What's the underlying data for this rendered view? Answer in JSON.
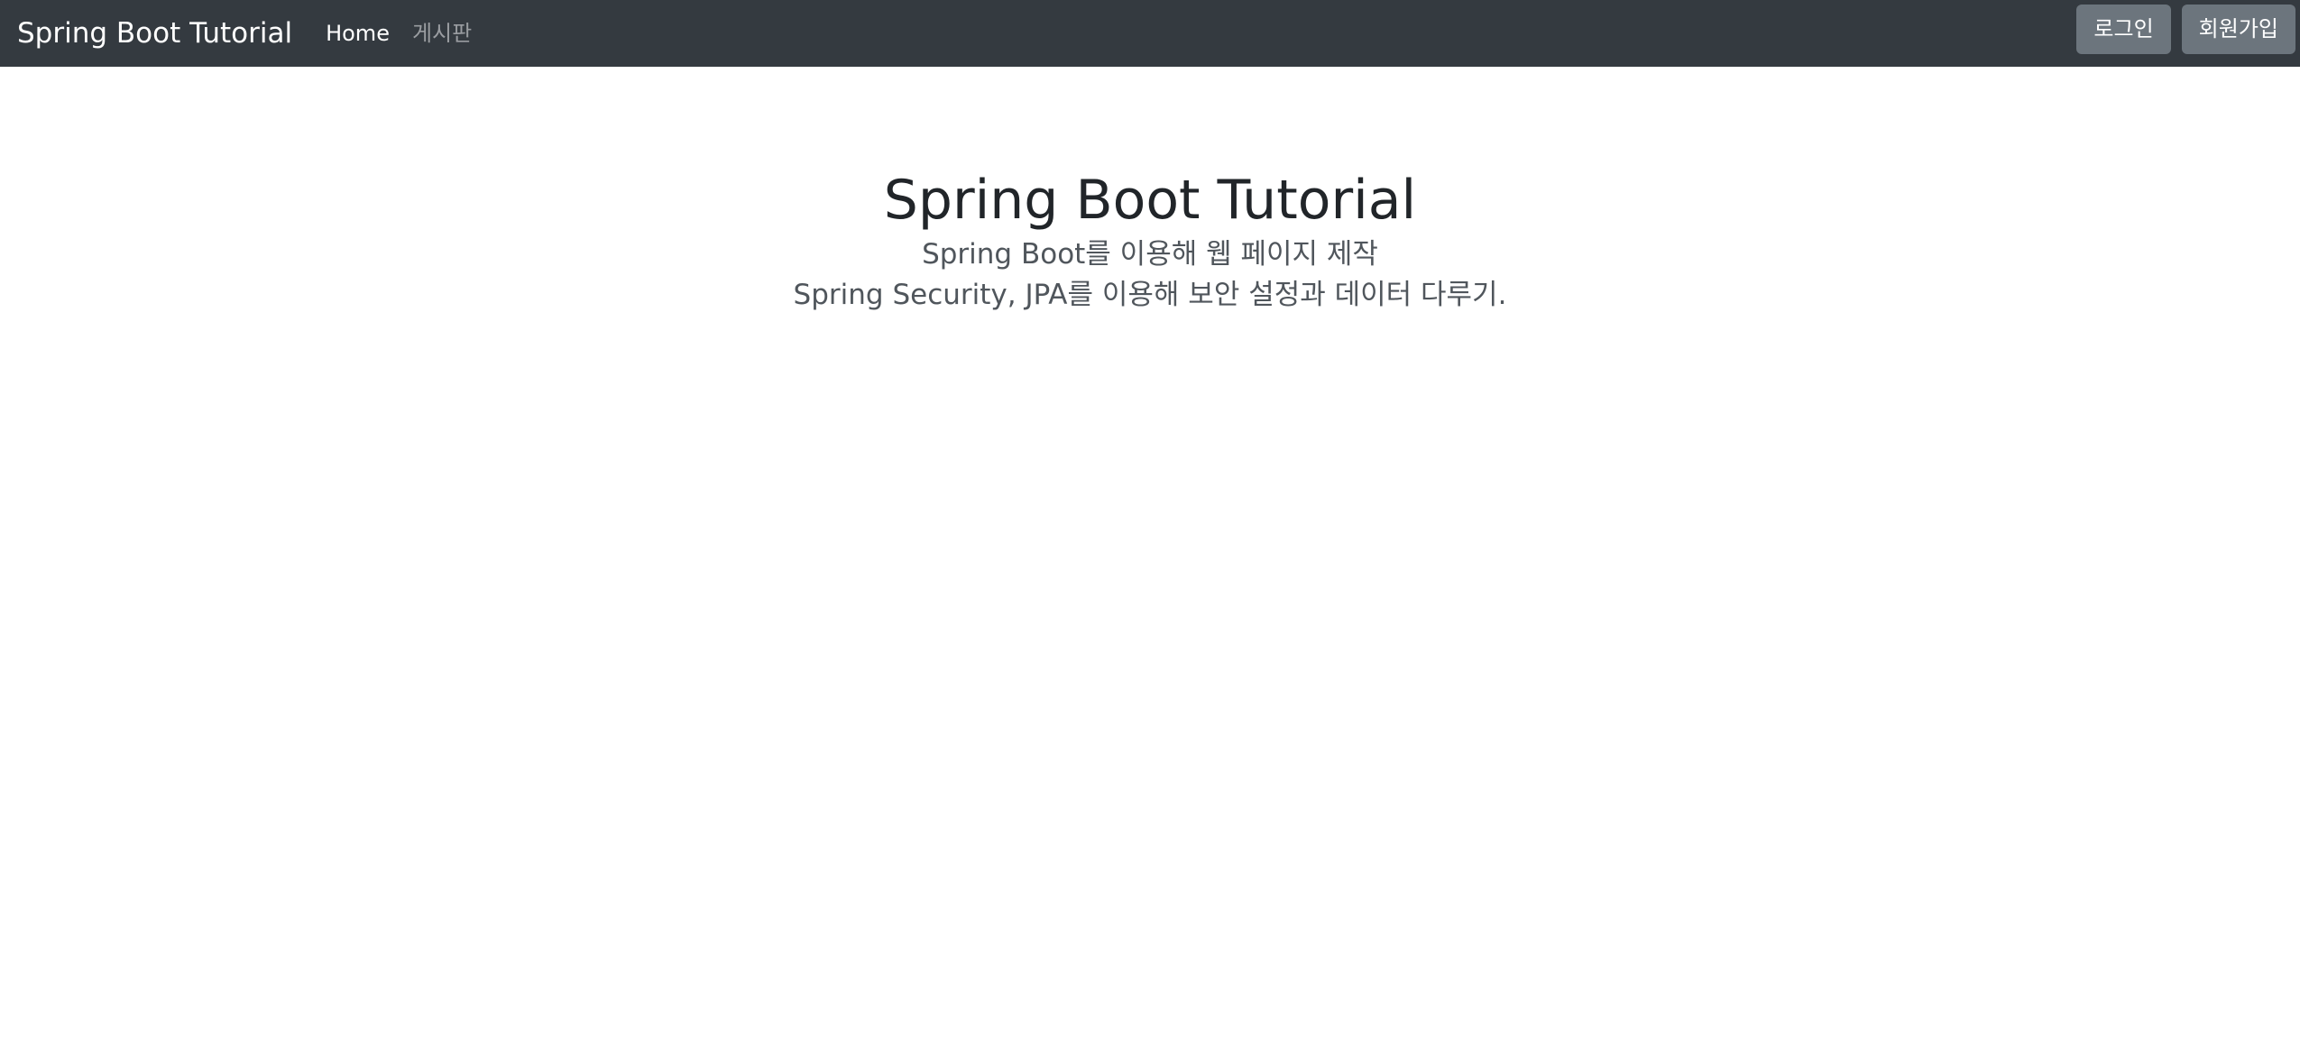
{
  "navbar": {
    "brand": "Spring Boot Tutorial",
    "links": [
      {
        "label": "Home",
        "active": true
      },
      {
        "label": "게시판",
        "active": false
      }
    ],
    "login_label": "로그인",
    "signup_label": "회원가입"
  },
  "hero": {
    "title": "Spring Boot Tutorial",
    "line1": "Spring Boot를 이용해 웹 페이지 제작",
    "line2": "Spring Security, JPA를 이용해 보안 설정과 데이터 다루기."
  },
  "colors": {
    "navbar_bg": "#343a40",
    "button_bg": "#6c757d",
    "text_dark": "#212529",
    "text_muted": "#50565c"
  }
}
